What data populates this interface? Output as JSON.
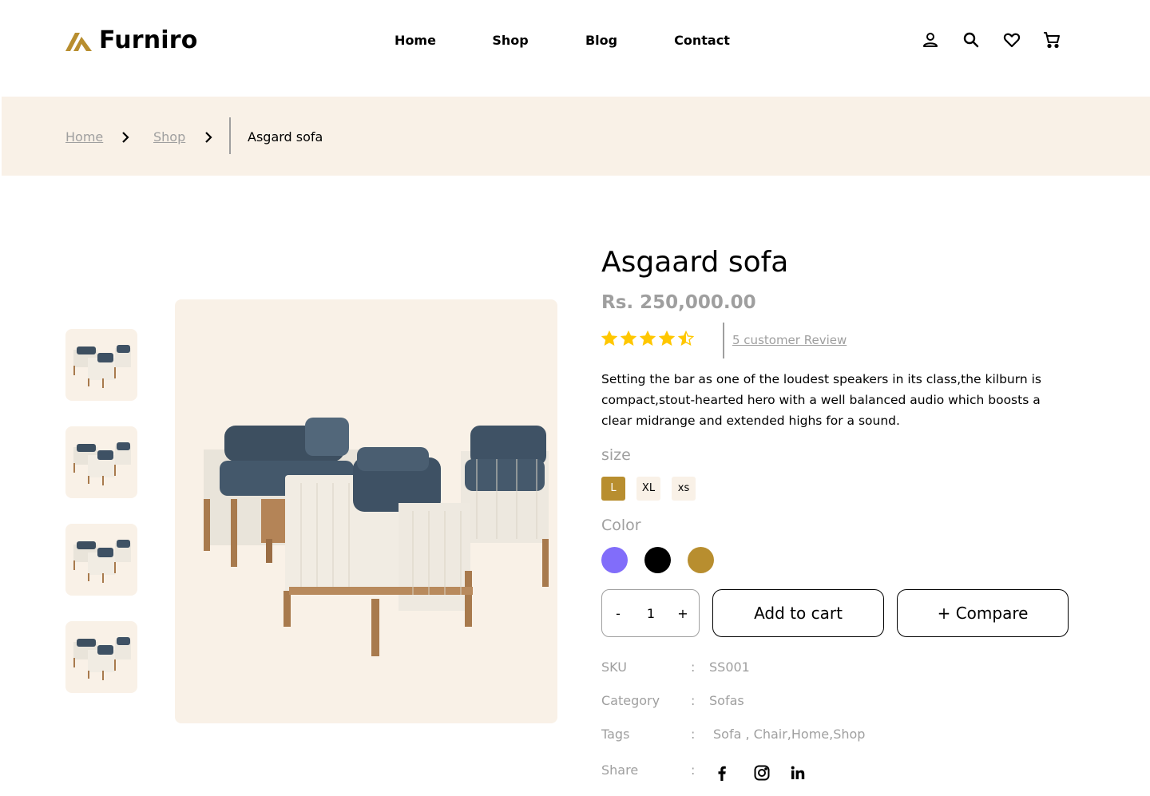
{
  "brand": {
    "name": "Furniro",
    "accent": "#B88E2F"
  },
  "nav": {
    "items": [
      "Home",
      "Shop",
      "Blog",
      "Contact"
    ]
  },
  "header_icons": [
    "user-icon",
    "search-icon",
    "heart-icon",
    "cart-icon"
  ],
  "breadcrumb": {
    "items": [
      "Home",
      "Shop"
    ],
    "current": "Asgard sofa"
  },
  "product": {
    "title": "Asgaard sofa",
    "price": "Rs. 250,000.00",
    "rating": 4.5,
    "rating_max": 5,
    "review_text": "5 customer Review",
    "description": "Setting the bar as one of the loudest speakers in its class,the kilburn is compact,stout-hearted hero with a well balanced audio which boosts a clear midrange and extended highs for a sound.",
    "size_label": "size",
    "sizes": [
      "L",
      "XL",
      "xs"
    ],
    "selected_size": "L",
    "color_label": "Color",
    "colors": [
      "#816DFA",
      "#000000",
      "#B88E2F"
    ],
    "quantity": "1",
    "qty_minus": "-",
    "qty_plus": "+",
    "add_to_cart": "Add to cart",
    "compare": "+ Compare",
    "thumbnail_count": 4,
    "meta": {
      "separator": ":",
      "sku_label": "SKU",
      "sku": "SS001",
      "category_label": "Category",
      "category": "Sofas",
      "tags_label": "Tags",
      "tags": "Sofa , Chair,Home,Shop",
      "share_label": "Share",
      "share_icons": [
        "facebook-icon",
        "instagram-icon",
        "linkedin-icon"
      ]
    }
  },
  "colors": {
    "cream": "#F9F1E7",
    "muted_text": "#9F9F9F",
    "star": "#FFC700"
  }
}
